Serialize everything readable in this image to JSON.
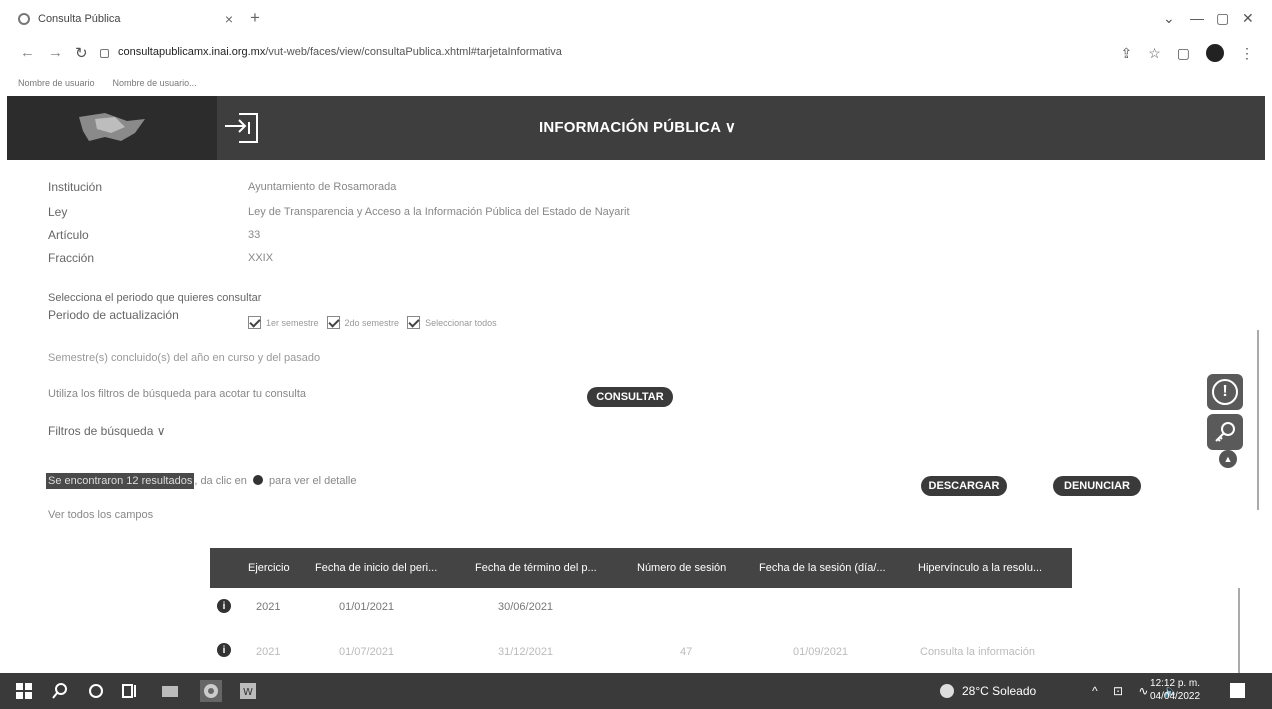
{
  "browser": {
    "tab_title": "Consulta Pública",
    "tab_close": "×",
    "new_tab": "+",
    "url_domain": "consultapublicamx.inai.org.mx",
    "url_path": "/vut-web/faces/view/consultaPublica.xhtml#tarjetaInformativa",
    "bookmarks": [
      "Nombre de usuario",
      "Nombre de usuario..."
    ],
    "min": "—",
    "max": "▢",
    "close": "✕",
    "chevron": "⌄"
  },
  "header": {
    "title": "INFORMACIÓN PÚBLICA ∨"
  },
  "info": {
    "institucion_label": "Institución",
    "institucion_value": "Ayuntamiento de Rosamorada",
    "ley_label": "Ley",
    "ley_value": "Ley de Transparencia y Acceso a la Información Pública del Estado de Nayarit",
    "articulo_label": "Artículo",
    "articulo_value": "33",
    "fraccion_label": "Fracción",
    "fraccion_value": "XXIX"
  },
  "period": {
    "prompt": "Selecciona el periodo que quieres consultar",
    "label": "Periodo de actualización",
    "options": [
      "1er semestre",
      "2do semestre",
      "Seleccionar todos"
    ]
  },
  "notes": {
    "semester_note": "Semestre(s) concluido(s) del año en curso y del pasado",
    "filter_hint": "Utiliza los filtros de búsqueda para acotar tu consulta",
    "filters_toggle": "Filtros de búsqueda ∨",
    "results_highlight": "Se encontraron 12 resultados",
    "results_rest_1": ", da clic en",
    "results_rest_2": "para ver el detalle",
    "view_all": "Ver todos los campos"
  },
  "buttons": {
    "consultar": "CONSULTAR",
    "descargar": "DESCARGAR",
    "denunciar": "DENUNCIAR"
  },
  "table": {
    "headers": [
      "Ejercicio",
      "Fecha de inicio del peri...",
      "Fecha de término del p...",
      "Número de sesión",
      "Fecha de la sesión (día/...",
      "Hipervínculo a la resolu..."
    ],
    "rows": [
      [
        "2021",
        "01/01/2021",
        "30/06/2021",
        "",
        "",
        ""
      ],
      [
        "2021",
        "01/07/2021",
        "31/12/2021",
        "47",
        "01/09/2021",
        "Consulta la información"
      ]
    ]
  },
  "taskbar": {
    "weather": "28°C  Soleado",
    "time": "12:12 p. m.",
    "date": "04/04/2022"
  }
}
